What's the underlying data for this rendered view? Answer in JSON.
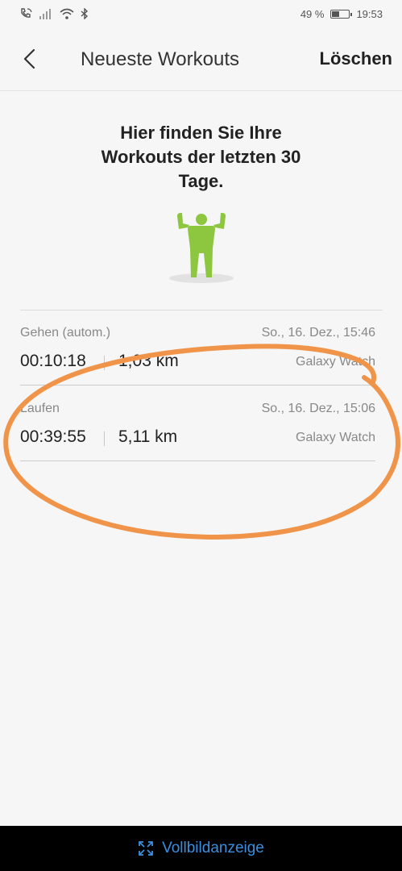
{
  "status_bar": {
    "battery": "49 %",
    "battery_level": 0.49,
    "time": "19:53",
    "icons": [
      "phone-wifi-call-icon",
      "signal-icon",
      "wifi-icon",
      "bluetooth-icon",
      "battery-icon"
    ]
  },
  "app_bar": {
    "back_icon": "chevron-left-icon",
    "title": "Neueste Workouts",
    "action": "Löschen"
  },
  "headline": [
    "Hier finden Sie Ihre",
    "Workouts der letzten 30",
    "Tage."
  ],
  "illustration": {
    "icon": "flexing-person-icon",
    "color": "#8dc63f"
  },
  "workouts": [
    {
      "type": "Gehen (autom.)",
      "date": "So., 16. Dez., 15:46",
      "duration": "00:10:18",
      "distance": "1,03 km",
      "device": "Galaxy Watch"
    },
    {
      "type": "Laufen",
      "date": "So., 16. Dez., 15:06",
      "duration": "00:39:55",
      "distance": "5,11 km",
      "device": "Galaxy Watch"
    }
  ],
  "annotation": {
    "shape": "hand-drawn-ellipse",
    "color": "#f0944a"
  },
  "bottom_bar": {
    "icon": "fullscreen-expand-icon",
    "label": "Vollbildanzeige",
    "color": "#3a8fe0"
  }
}
